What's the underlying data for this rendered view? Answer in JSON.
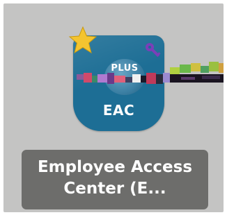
{
  "app": {
    "badge_text": "PLUS",
    "icon_text": "EAC",
    "label_line1": "Employee Access",
    "label_line2": "Center (E...",
    "favorite_icon": "star-icon",
    "access_icon": "key-icon"
  },
  "colors": {
    "tile_background": "#c4c4c3",
    "icon_background": "#1d6e95",
    "label_background": "#6d6d6b",
    "star": "#f4c430",
    "key": "#7b3fb8"
  }
}
